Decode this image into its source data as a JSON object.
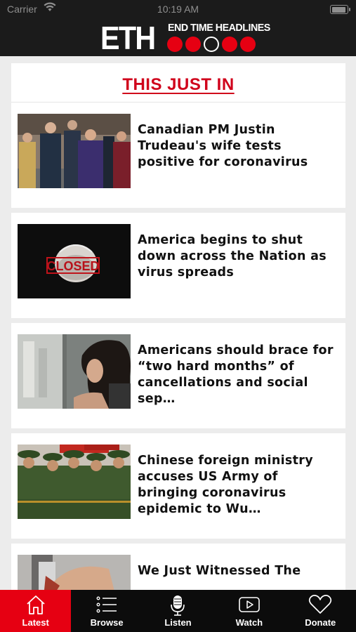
{
  "status_bar": {
    "carrier": "Carrier",
    "time": "10:19 AM",
    "battery_level": 0.95
  },
  "header": {
    "logo": "ETH",
    "subtitle": "END TIME HEADLINES",
    "dot_count": 5,
    "active_dot": 3
  },
  "banner": {
    "title": "THIS JUST IN"
  },
  "articles": [
    {
      "headline": "Canadian PM Justin Trudeau's wife tests positive for coronavirus",
      "image": "trudeau-group-photo"
    },
    {
      "headline": "America begins to shut down across the Nation as virus spreads",
      "image": "closed-mask-photo",
      "image_text": "CLOSED"
    },
    {
      "headline": "Americans should brace for “two hard months” of cancellations and social sep…",
      "image": "woman-at-window-photo"
    },
    {
      "headline": "Chinese foreign ministry accuses US Army of bringing coronavirus epidemic to Wu…",
      "image": "chinese-soldiers-photo"
    },
    {
      "headline": "We Just Witnessed The",
      "image": "hand-photo"
    }
  ],
  "tabs": [
    {
      "label": "Latest",
      "icon": "home-icon",
      "active": true
    },
    {
      "label": "Browse",
      "icon": "list-icon",
      "active": false
    },
    {
      "label": "Listen",
      "icon": "microphone-icon",
      "active": false
    },
    {
      "label": "Watch",
      "icon": "play-icon",
      "active": false
    },
    {
      "label": "Donate",
      "icon": "heart-icon",
      "active": false
    }
  ],
  "colors": {
    "accent": "#e60012",
    "headline_red": "#d0021b",
    "bar": "#1b1b1b",
    "tabbar": "#0c0c0c"
  }
}
